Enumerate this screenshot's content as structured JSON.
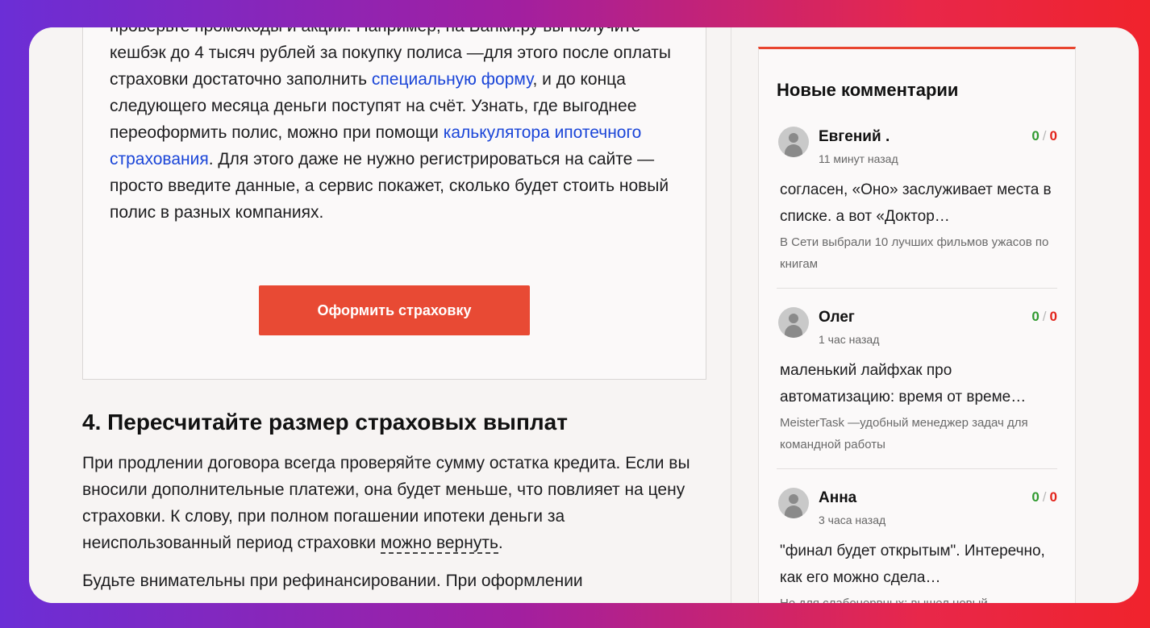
{
  "promo": {
    "text_before_link1": "проверьте промокоды и акции. Например, на Банки.ру вы получите кешбэк до 4 тысяч рублей за покупку полиса —для этого после оплаты страховки достаточно заполнить ",
    "link1": "специальную форму",
    "text_after_link1": ", и до конца следующего месяца деньги поступят на счёт. Узнать, где выгоднее переоформить полис, можно при помощи ",
    "link2": "калькулятора ипотечного страхования",
    "text_after_link2": ". Для этого даже не нужно регистрироваться на сайте —просто введите данные, а сервис покажет, сколько будет стоить новый полис в разных компаниях.",
    "button_label": "Оформить страховку"
  },
  "section": {
    "heading": "4. Пересчитайте размер страховых выплат",
    "para1_before": "При продлении договора всегда проверяйте сумму остатка кредита. Если вы вносили дополнительные платежи, она будет меньше, что повлияет на цену страховки. К слову, при полном погашении ипотеки деньги за неиспользованный период страховки ",
    "para1_link": "можно вернуть",
    "para1_after": ".",
    "para2": "Будьте внимательны при рефинансировании. При оформлении"
  },
  "sidebar": {
    "title": "Новые комментарии",
    "comments": [
      {
        "name": "Евгений .",
        "time": "11 минут назад",
        "up": "0",
        "sep": "/",
        "down": "0",
        "text": "согласен, «Оно» заслуживает места в списке. а вот «Доктор…",
        "source": "В Сети выбрали 10 лучших фильмов ужасов по книгам"
      },
      {
        "name": "Олег",
        "time": "1 час назад",
        "up": "0",
        "sep": "/",
        "down": "0",
        "text": "маленький лайфхак про автоматизацию: время от време…",
        "source": "MeisterTask —удобный менеджер задач для командной работы"
      },
      {
        "name": "Анна",
        "time": "3 часа назад",
        "up": "0",
        "sep": "/",
        "down": "0",
        "text": "\"финал будет открытым\". Интеречно, как его можно сдела…",
        "source": "Не для слабонервных: вышел новый"
      }
    ]
  },
  "colors": {
    "accent": "#e84a34",
    "link": "#1a45d8",
    "vote_up": "#2f9a2f",
    "vote_down": "#e2231a"
  }
}
